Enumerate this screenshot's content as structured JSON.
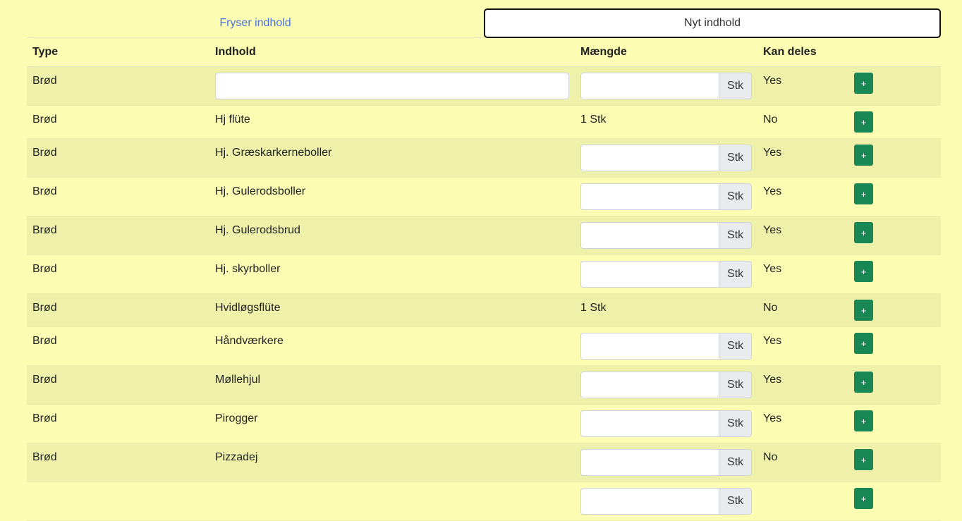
{
  "tabs": {
    "left_label": "Fryser indhold",
    "right_label": "Nyt indhold"
  },
  "table": {
    "headers": [
      "Type",
      "Indhold",
      "Mængde",
      "Kan deles",
      ""
    ],
    "unit_label": "Stk",
    "add_label": "+",
    "rows": [
      {
        "type": "Brød",
        "content": "",
        "content_is_input": true,
        "qty": "",
        "qty_is_input": true,
        "share": "Yes"
      },
      {
        "type": "Brød",
        "content": "Hj flüte",
        "content_is_input": false,
        "qty": "1 Stk",
        "qty_is_input": false,
        "share": "No"
      },
      {
        "type": "Brød",
        "content": "Hj. Græskarkerneboller",
        "content_is_input": false,
        "qty": "",
        "qty_is_input": true,
        "share": "Yes"
      },
      {
        "type": "Brød",
        "content": "Hj. Gulerodsboller",
        "content_is_input": false,
        "qty": "",
        "qty_is_input": true,
        "share": "Yes"
      },
      {
        "type": "Brød",
        "content": "Hj. Gulerodsbrud",
        "content_is_input": false,
        "qty": "",
        "qty_is_input": true,
        "share": "Yes"
      },
      {
        "type": "Brød",
        "content": "Hj. skyrboller",
        "content_is_input": false,
        "qty": "",
        "qty_is_input": true,
        "share": "Yes"
      },
      {
        "type": "Brød",
        "content": "Hvidløgsflüte",
        "content_is_input": false,
        "qty": "1 Stk",
        "qty_is_input": false,
        "share": "No"
      },
      {
        "type": "Brød",
        "content": "Håndværkere",
        "content_is_input": false,
        "qty": "",
        "qty_is_input": true,
        "share": "Yes"
      },
      {
        "type": "Brød",
        "content": "Møllehjul",
        "content_is_input": false,
        "qty": "",
        "qty_is_input": true,
        "share": "Yes"
      },
      {
        "type": "Brød",
        "content": "Pirogger",
        "content_is_input": false,
        "qty": "",
        "qty_is_input": true,
        "share": "Yes"
      },
      {
        "type": "Brød",
        "content": "Pizzadej",
        "content_is_input": false,
        "qty": "",
        "qty_is_input": true,
        "share": "No"
      },
      {
        "type": "",
        "content": "",
        "content_is_input": false,
        "qty": "",
        "qty_is_input": true,
        "share": ""
      }
    ]
  }
}
